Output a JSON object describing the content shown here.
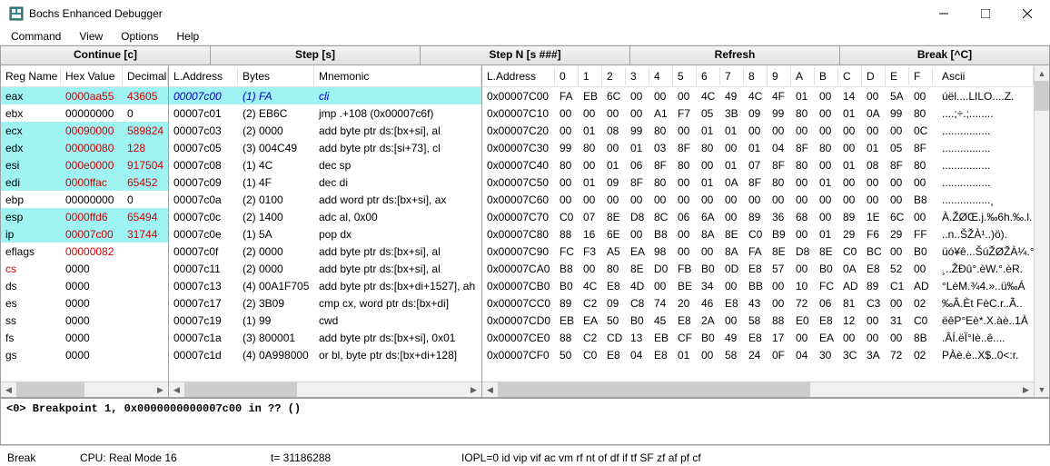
{
  "window": {
    "title": "Bochs Enhanced Debugger"
  },
  "menubar": [
    "Command",
    "View",
    "Options",
    "Help"
  ],
  "toolbar": [
    "Continue [c]",
    "Step [s]",
    "Step N [s ###]",
    "Refresh",
    "Break [^C]"
  ],
  "regs": {
    "headers": [
      "Reg Name",
      "Hex Value",
      "Decimal"
    ],
    "rows": [
      {
        "n": "eax",
        "h": "0000aa55",
        "d": "43605",
        "c": true
      },
      {
        "n": "ebx",
        "h": "00000000",
        "d": "0"
      },
      {
        "n": "ecx",
        "h": "00090000",
        "d": "589824",
        "c": true
      },
      {
        "n": "edx",
        "h": "00000080",
        "d": "128",
        "c": true
      },
      {
        "n": "esi",
        "h": "000e0000",
        "d": "917504",
        "c": true
      },
      {
        "n": "edi",
        "h": "0000ffac",
        "d": "65452",
        "c": true
      },
      {
        "n": "ebp",
        "h": "00000000",
        "d": "0"
      },
      {
        "n": "esp",
        "h": "0000ffd6",
        "d": "65494",
        "c": true
      },
      {
        "n": "ip",
        "h": "00007c00",
        "d": "31744",
        "c": true
      },
      {
        "n": "eflags",
        "h": "00000082",
        "d": "",
        "f": true
      },
      {
        "n": "cs",
        "h": "0000",
        "d": "",
        "s": true
      },
      {
        "n": "ds",
        "h": "0000",
        "d": ""
      },
      {
        "n": "es",
        "h": "0000",
        "d": ""
      },
      {
        "n": "ss",
        "h": "0000",
        "d": ""
      },
      {
        "n": "fs",
        "h": "0000",
        "d": ""
      },
      {
        "n": "gs",
        "h": "0000",
        "d": ""
      }
    ]
  },
  "disasm": {
    "headers": [
      "L.Address",
      "Bytes",
      "Mnemonic"
    ],
    "rows": [
      {
        "a": "00007c00",
        "b": "(1) FA",
        "m": "cli",
        "cur": true
      },
      {
        "a": "00007c01",
        "b": "(2) EB6C",
        "m": "jmp .+108 (0x00007c6f)"
      },
      {
        "a": "00007c03",
        "b": "(2) 0000",
        "m": "add byte ptr ds:[bx+si], al"
      },
      {
        "a": "00007c05",
        "b": "(3) 004C49",
        "m": "add byte ptr ds:[si+73], cl"
      },
      {
        "a": "00007c08",
        "b": "(1) 4C",
        "m": "dec sp"
      },
      {
        "a": "00007c09",
        "b": "(1) 4F",
        "m": "dec di"
      },
      {
        "a": "00007c0a",
        "b": "(2) 0100",
        "m": "add word ptr ds:[bx+si], ax"
      },
      {
        "a": "00007c0c",
        "b": "(2) 1400",
        "m": "adc al, 0x00"
      },
      {
        "a": "00007c0e",
        "b": "(1) 5A",
        "m": "pop dx"
      },
      {
        "a": "00007c0f",
        "b": "(2) 0000",
        "m": "add byte ptr ds:[bx+si], al"
      },
      {
        "a": "00007c11",
        "b": "(2) 0000",
        "m": "add byte ptr ds:[bx+si], al"
      },
      {
        "a": "00007c13",
        "b": "(4) 00A1F705",
        "m": "add byte ptr ds:[bx+di+1527], ah"
      },
      {
        "a": "00007c17",
        "b": "(2) 3B09",
        "m": "cmp cx, word ptr ds:[bx+di]"
      },
      {
        "a": "00007c19",
        "b": "(1) 99",
        "m": "cwd"
      },
      {
        "a": "00007c1a",
        "b": "(3) 800001",
        "m": "add byte ptr ds:[bx+si], 0x01"
      },
      {
        "a": "00007c1d",
        "b": "(4) 0A998000",
        "m": "or bl, byte ptr ds:[bx+di+128]"
      }
    ]
  },
  "mem": {
    "headers": [
      "L.Address",
      "0",
      "1",
      "2",
      "3",
      "4",
      "5",
      "6",
      "7",
      "8",
      "9",
      "A",
      "B",
      "C",
      "D",
      "E",
      "F",
      "Ascii"
    ],
    "rows": [
      {
        "a": "0x00007C00",
        "b": [
          "FA",
          "EB",
          "6C",
          "00",
          "00",
          "00",
          "4C",
          "49",
          "4C",
          "4F",
          "01",
          "00",
          "14",
          "00",
          "5A",
          "00"
        ],
        "s": "úël....LILO....Z."
      },
      {
        "a": "0x00007C10",
        "b": [
          "00",
          "00",
          "00",
          "00",
          "A1",
          "F7",
          "05",
          "3B",
          "09",
          "99",
          "80",
          "00",
          "01",
          "0A",
          "99",
          "80"
        ],
        "s": "....;÷.;........"
      },
      {
        "a": "0x00007C20",
        "b": [
          "00",
          "01",
          "08",
          "99",
          "80",
          "00",
          "01",
          "01",
          "00",
          "00",
          "00",
          "00",
          "00",
          "00",
          "00",
          "0C"
        ],
        "s": "................"
      },
      {
        "a": "0x00007C30",
        "b": [
          "99",
          "80",
          "00",
          "01",
          "03",
          "8F",
          "80",
          "00",
          "01",
          "04",
          "8F",
          "80",
          "00",
          "01",
          "05",
          "8F"
        ],
        "s": "................"
      },
      {
        "a": "0x00007C40",
        "b": [
          "80",
          "00",
          "01",
          "06",
          "8F",
          "80",
          "00",
          "01",
          "07",
          "8F",
          "80",
          "00",
          "01",
          "08",
          "8F",
          "80"
        ],
        "s": "................"
      },
      {
        "a": "0x00007C50",
        "b": [
          "00",
          "01",
          "09",
          "8F",
          "80",
          "00",
          "01",
          "0A",
          "8F",
          "80",
          "00",
          "01",
          "00",
          "00",
          "00",
          "00"
        ],
        "s": "................"
      },
      {
        "a": "0x00007C60",
        "b": [
          "00",
          "00",
          "00",
          "00",
          "00",
          "00",
          "00",
          "00",
          "00",
          "00",
          "00",
          "00",
          "00",
          "00",
          "00",
          "B8"
        ],
        "s": "................¸"
      },
      {
        "a": "0x00007C70",
        "b": [
          "C0",
          "07",
          "8E",
          "D8",
          "8C",
          "06",
          "6A",
          "00",
          "89",
          "36",
          "68",
          "00",
          "89",
          "1E",
          "6C",
          "00"
        ],
        "s": "À.ŽØŒ.j.‰6h.‰.l."
      },
      {
        "a": "0x00007C80",
        "b": [
          "88",
          "16",
          "6E",
          "00",
          "B8",
          "00",
          "8A",
          "8E",
          "C0",
          "B9",
          "00",
          "01",
          "29",
          "F6",
          "29",
          "FF"
        ],
        "s": "..n..ŠŽÀ¹..)ö)."
      },
      {
        "a": "0x00007C90",
        "b": [
          "FC",
          "F3",
          "A5",
          "EA",
          "98",
          "00",
          "00",
          "8A",
          "FA",
          "8E",
          "D8",
          "8E",
          "C0",
          "BC",
          "00",
          "B0"
        ],
        "s": "üó¥ê...ŠúŽØŽÀ¼.°"
      },
      {
        "a": "0x00007CA0",
        "b": [
          "B8",
          "00",
          "80",
          "8E",
          "D0",
          "FB",
          "B0",
          "0D",
          "E8",
          "57",
          "00",
          "B0",
          "0A",
          "E8",
          "52",
          "00"
        ],
        "s": "¸..ŽÐû°.èW.°.èR."
      },
      {
        "a": "0x00007CB0",
        "b": [
          "B0",
          "4C",
          "E8",
          "4D",
          "00",
          "BE",
          "34",
          "00",
          "BB",
          "00",
          "10",
          "FC",
          "AD",
          "89",
          "C1",
          "AD"
        ],
        "s": "°LèM.¾4.»..ü­‰Á­"
      },
      {
        "a": "0x00007CC0",
        "b": [
          "89",
          "C2",
          "09",
          "C8",
          "74",
          "20",
          "46",
          "E8",
          "43",
          "00",
          "72",
          "06",
          "81",
          "C3",
          "00",
          "02"
        ],
        "s": "‰Â.Èt FèC.r..Ã.."
      },
      {
        "a": "0x00007CD0",
        "b": [
          "EB",
          "EA",
          "50",
          "B0",
          "45",
          "E8",
          "2A",
          "00",
          "58",
          "88",
          "E0",
          "E8",
          "12",
          "00",
          "31",
          "C0"
        ],
        "s": "ëêP°Eè*.X.àè..1À"
      },
      {
        "a": "0x00007CE0",
        "b": [
          "88",
          "C2",
          "CD",
          "13",
          "EB",
          "CF",
          "B0",
          "49",
          "E8",
          "17",
          "00",
          "EA",
          "00",
          "00",
          "00",
          "8B"
        ],
        "s": ".ÂÍ.ëÏ°Iè..ê...."
      },
      {
        "a": "0x00007CF0",
        "b": [
          "50",
          "C0",
          "E8",
          "04",
          "E8",
          "01",
          "00",
          "58",
          "24",
          "0F",
          "04",
          "30",
          "3C",
          "3A",
          "72",
          "02"
        ],
        "s": "PÀè.è..X$..0<:r."
      }
    ]
  },
  "console": "<0> Breakpoint 1, 0x0000000000007c00 in ?? ()",
  "status": {
    "s0": "Break",
    "s1": "CPU: Real Mode 16",
    "s2": "t= 31186288",
    "s3": "IOPL=0 id vip vif ac vm rf nt of df if tf SF zf af pf cf"
  }
}
